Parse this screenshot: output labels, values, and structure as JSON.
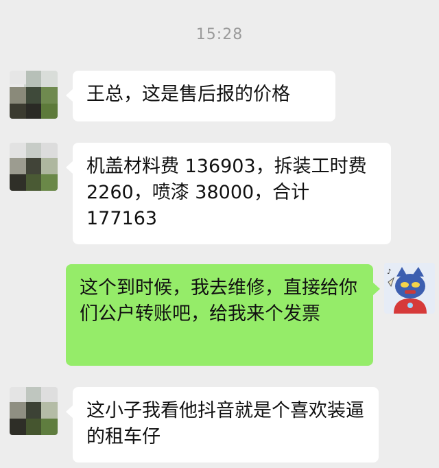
{
  "chat": {
    "timestamp": "15:28",
    "messages": [
      {
        "sender": "other",
        "text": "王总，这是售后报的价格"
      },
      {
        "sender": "other",
        "text": "机盖材料费 136903，拆装工时费 2260，喷漆 38000，合计 177163"
      },
      {
        "sender": "self",
        "text": "这个到时候，我去维修，直接给你们公户转账吧，给我来个发票"
      },
      {
        "sender": "other",
        "text": "这小子我看他抖音就是个喜欢装逼的租车仔"
      }
    ]
  },
  "colors": {
    "background": "#ededed",
    "incoming_bubble": "#ffffff",
    "outgoing_bubble": "#95ec69",
    "timestamp_text": "#9a9a9a"
  },
  "icons": {
    "contact_avatar": "pixelated-avatar-icon",
    "self_avatar": "cartoon-ultraman-avatar-icon"
  }
}
